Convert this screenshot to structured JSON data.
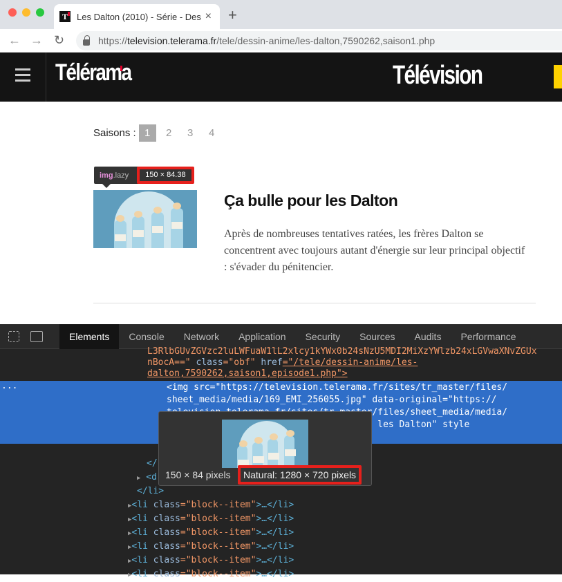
{
  "browser": {
    "tab_title": "Les Dalton (2010) - Série - Des",
    "tab_close": "×",
    "new_tab": "+",
    "url_prefix": "https://",
    "url_host": "television.telerama.fr",
    "url_path": "/tele/dessin-anime/les-dalton,7590262,saison1.php"
  },
  "site": {
    "logo": "Télérama",
    "section": "Télévision"
  },
  "seasons": {
    "label": "Saisons :",
    "items": [
      "1",
      "2",
      "3",
      "4"
    ],
    "active": "1"
  },
  "inspector_tooltip": {
    "tag": "img",
    "class": ".lazy",
    "size": "150 × 84.38"
  },
  "episode": {
    "title": "Ça bulle pour les Dalton",
    "description": "Après de nombreuses tentatives ratées, les frères Dalton se concentrent avec toujours autant d'énergie sur leur principal objectif : s'évader du pénitencier."
  },
  "devtools": {
    "tabs": [
      "Elements",
      "Console",
      "Network",
      "Application",
      "Security",
      "Sources",
      "Audits",
      "Performance"
    ],
    "active_tab": "Elements",
    "lines": {
      "l0": "L3RlbGUvZGVzc2luLWFuaW1lL2xlcy1kYWx0b24sNzU5MDI2MiXzYWlzb24xLGVwaXNvZGUx",
      "l1_pre": "nBocA==\"",
      "l1_attr": " class",
      "l1_val": "=\"obf\"",
      "l1_attr2": " href",
      "l1_val2": "=\"/tele/dessin-anime/les-",
      "l2": "dalton,7590262,saison1,episode1.php\">",
      "sel1": "<img src=\"https://television.telerama.fr/sites/tr_master/files/",
      "sel2": "sheet_media/media/169_EMI_256055.jpg\" data-original=\"https://",
      "sel3": "television.telerama.fr/sites/tr_master/files/sheet_media/media/",
      "sel4": "169_EMI_256055.jpg\" alt=\"Ça bulle pour les Dalton\" style",
      "close_a": "</",
      "d": "<d",
      "close_li": "</li>",
      "li_open": "<li ",
      "li_attr": "class",
      "li_val": "=\"block--item\"",
      "li_rest": ">…</li>"
    },
    "popup": {
      "rendered": "150 × 84 pixels",
      "natural": "Natural: 1280 × 720 pixels"
    },
    "ellipsis": "..."
  }
}
